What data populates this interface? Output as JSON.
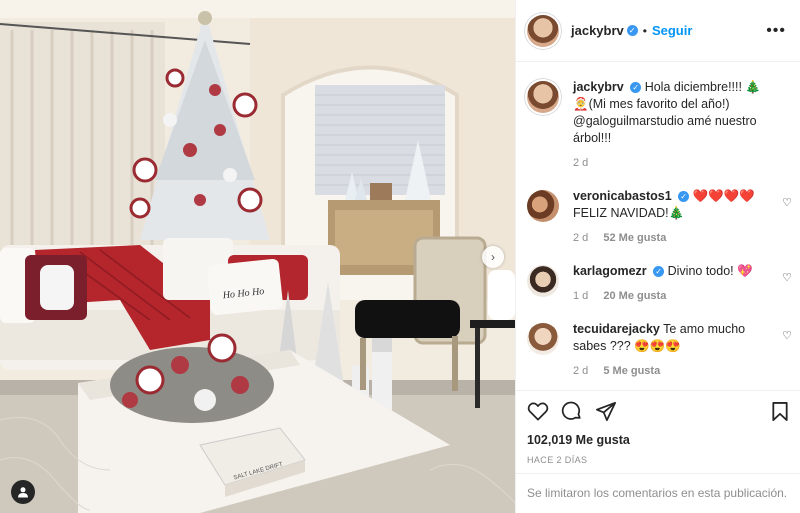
{
  "post": {
    "author": "jackybrv",
    "follow_label": "Seguir",
    "more_label": "•••",
    "next_arrow": "›",
    "photo_sign_text": "Ho Ho Ho",
    "book_text": "SALT LAKE DRIFT"
  },
  "caption": {
    "username": "jackybrv",
    "text": "Hola diciembre!!!! 🎄🤶(Mi mes favorito del año!) @galoguilmarstudio amé nuestro árbol!!!",
    "time": "2 d"
  },
  "comments": [
    {
      "username": "veronicabastos1",
      "verified": true,
      "text": "❤️❤️❤️❤️ FELIZ NAVIDAD!🎄",
      "time": "2 d",
      "likes": "52 Me gusta"
    },
    {
      "username": "karlagomezr",
      "verified": true,
      "text": "Divino todo! 💖",
      "time": "1 d",
      "likes": "20 Me gusta"
    },
    {
      "username": "tecuidarejacky",
      "verified": false,
      "text": "Te amo mucho sabes ??? 😍😍😍",
      "time": "2 d",
      "likes": "5 Me gusta"
    }
  ],
  "stats": {
    "likes": "102,019 Me gusta",
    "posted": "HACE 2 DÍAS"
  },
  "comments_disabled": "Se limitaron los comentarios en esta publicación.",
  "colors": {
    "link": "#0095f6",
    "muted": "#8e8e8e",
    "text": "#262626",
    "verified": "#3897f0"
  }
}
